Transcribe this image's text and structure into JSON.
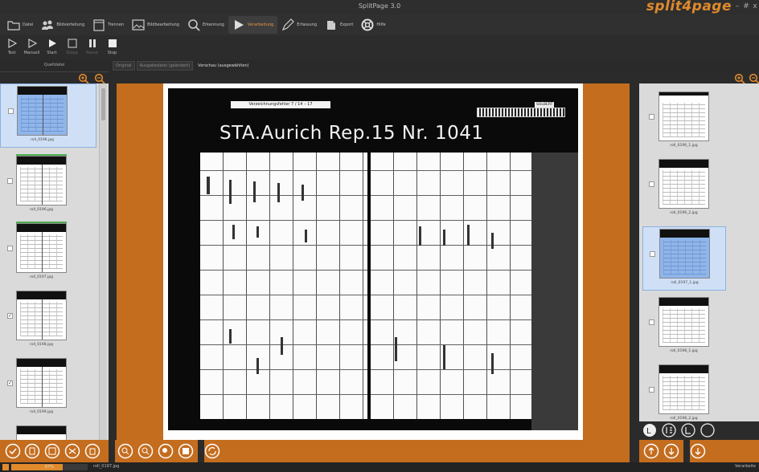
{
  "app": {
    "title": "SplitPage 3.0",
    "logo": "split4page",
    "window_controls": [
      "–",
      "#",
      "x"
    ]
  },
  "toolbar": {
    "items": [
      {
        "label": "Datei",
        "icon": "folder-icon"
      },
      {
        "label": "Bildverteilung",
        "icon": "people-icon"
      },
      {
        "label": "Trennen",
        "icon": "document-icon"
      },
      {
        "label": "Bildbearbeitung",
        "icon": "image-icon"
      },
      {
        "label": "Erkennung",
        "icon": "search-icon"
      },
      {
        "label": "Verarbeitung",
        "icon": "play-icon"
      },
      {
        "label": "Erfassung",
        "icon": "pen-icon"
      },
      {
        "label": "Export",
        "icon": "export-icon"
      },
      {
        "label": "Hilfe",
        "icon": "lifebuoy-icon"
      }
    ]
  },
  "process": {
    "buttons": [
      {
        "label": "Test",
        "icon": "play-outline-icon"
      },
      {
        "label": "Manuell",
        "icon": "play-outline-icon"
      },
      {
        "label": "Start",
        "icon": "play-icon"
      },
      {
        "label": "Stopp",
        "icon": "stop-outline-icon"
      },
      {
        "label": "Pause",
        "icon": "pause-icon"
      },
      {
        "label": "Stop",
        "icon": "stop-icon"
      }
    ]
  },
  "left_panel": {
    "header": "Quelldatei",
    "thumbnails": [
      {
        "name": "roll_0196.jpg",
        "selected": true,
        "checked": false
      },
      {
        "name": "roll_0196.jpg",
        "selected": false,
        "checked": false
      },
      {
        "name": "roll_0197.jpg",
        "selected": false,
        "checked": false
      },
      {
        "name": "roll_0198.jpg",
        "selected": false,
        "checked": true
      },
      {
        "name": "roll_0199.jpg",
        "selected": false,
        "checked": true
      },
      {
        "name": "",
        "selected": false,
        "checked": false
      }
    ]
  },
  "tabs": [
    "Original",
    "Ausgabedatei (geändert)",
    "Vorschau (ausgewählten)"
  ],
  "document": {
    "archive_label": "Verzeichnungsfehler 7 / 14 – 17",
    "title": "STA.Aurich Rep.15  Nr.  1041",
    "side_label": "SOLBERT"
  },
  "right_panel": {
    "thumbnails": [
      {
        "name": "roll_0196_1.jpg",
        "selected": false
      },
      {
        "name": "roll_0196_2.jpg",
        "selected": false
      },
      {
        "name": "roll_0197_1.jpg",
        "selected": true
      },
      {
        "name": "roll_0198_1.jpg",
        "selected": false
      },
      {
        "name": "roll_0198_2.jpg",
        "selected": false
      }
    ]
  },
  "status": {
    "progress_percent": 67,
    "progress_text": "67%",
    "filename": "roll_0197.jpg",
    "right_text": "Verarbeite"
  }
}
